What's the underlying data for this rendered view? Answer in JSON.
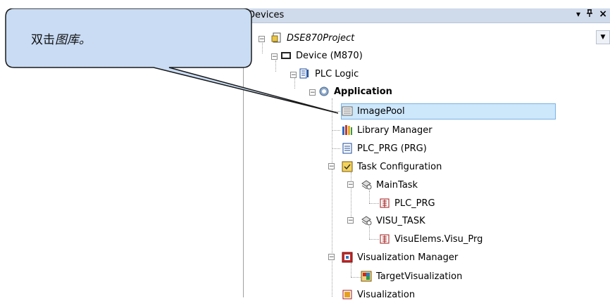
{
  "callout": {
    "text_normal": "双击",
    "text_italic": "图库。"
  },
  "panel": {
    "title": "Devices",
    "pin_glyph": "ᵖ",
    "close_glyph": "×",
    "dropdown_glyph": "▼"
  },
  "tree": {
    "project": "DSE870Project",
    "device": "Device (M870)",
    "plc_logic": "PLC Logic",
    "application": "Application",
    "image_pool": "ImagePool",
    "library_manager": "Library Manager",
    "plc_prg": "PLC_PRG (PRG)",
    "task_configuration": "Task Configuration",
    "main_task": "MainTask",
    "main_task_child": "PLC_PRG",
    "visu_task": "VISU_TASK",
    "visu_task_child": "VisuElems.Visu_Prg",
    "visualization_manager": "Visualization Manager",
    "target_visualization": "TargetVisualization",
    "visualization": "Visualization"
  },
  "colors": {
    "selection": "#cde7fb",
    "titlebar": "#cfdaea",
    "callout_fill": "#c9dcf4"
  }
}
